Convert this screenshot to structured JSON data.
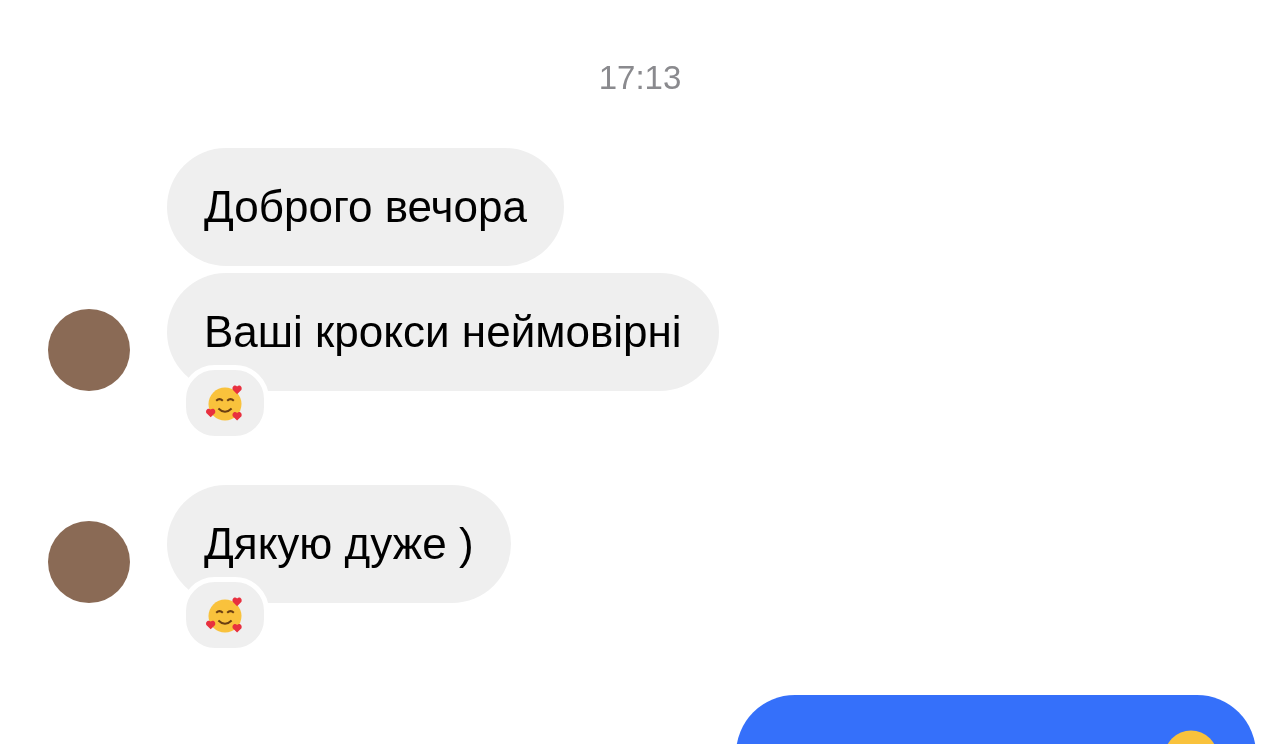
{
  "timestamp": "17:13",
  "groups": [
    {
      "kind": "incoming",
      "messages": [
        {
          "text": "Доброго вечора",
          "reaction": false
        },
        {
          "text": "Ваші крокси неймовірні",
          "reaction": true
        }
      ]
    },
    {
      "kind": "incoming",
      "messages": [
        {
          "text": "Дякую дуже )",
          "reaction": true
        }
      ]
    },
    {
      "kind": "outgoing",
      "messages": [
        {
          "emoji": true
        }
      ]
    }
  ]
}
